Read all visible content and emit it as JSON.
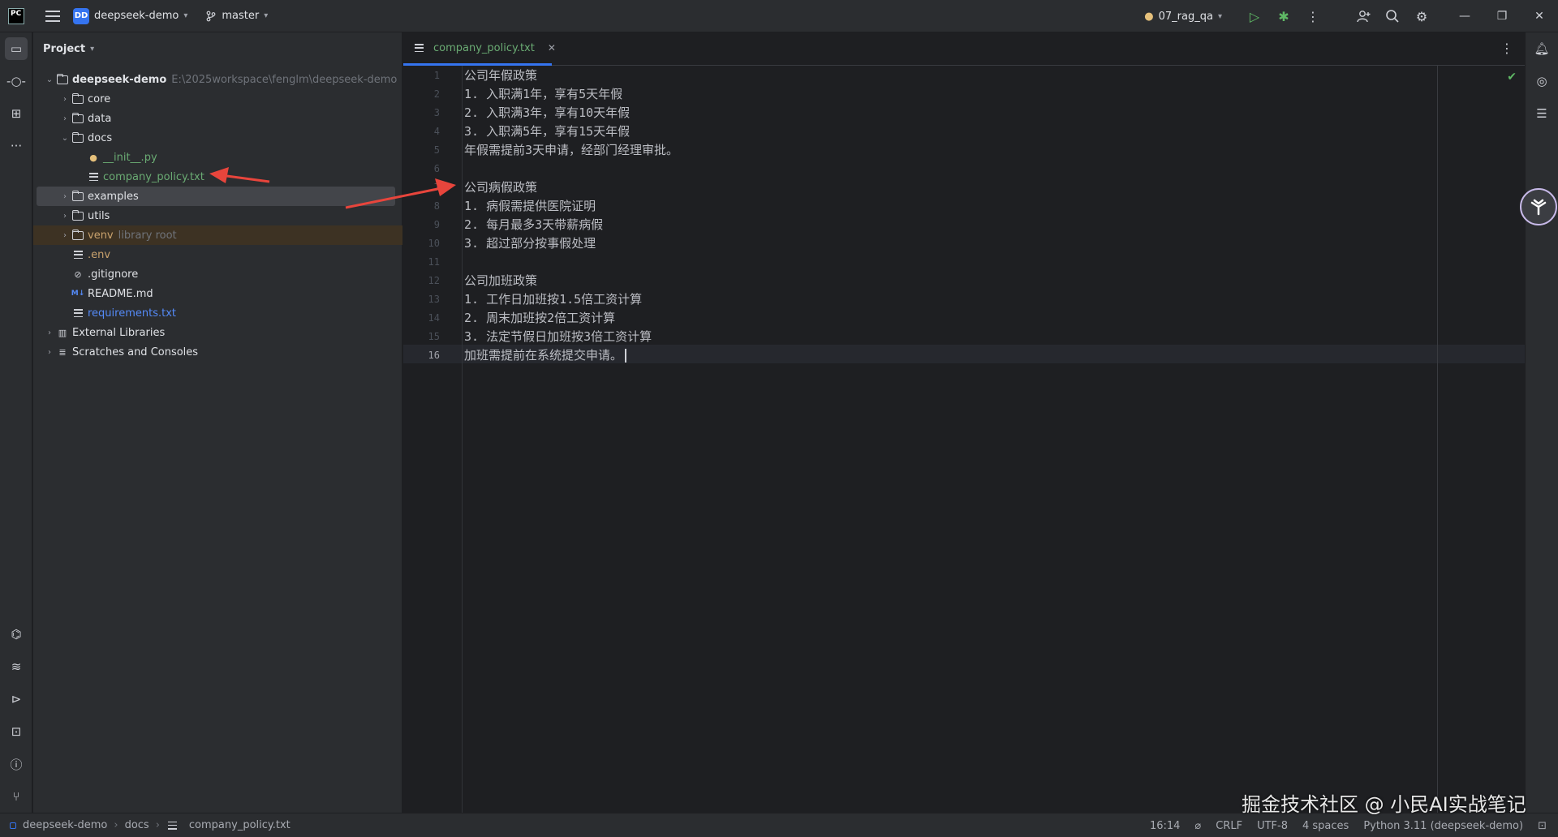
{
  "titlebar": {
    "logo": "PC",
    "project_badge": "DD",
    "project_name": "deepseek-demo",
    "branch": "master",
    "run_config": "07_rag_qa"
  },
  "project_panel": {
    "title": "Project",
    "tree": [
      {
        "label": "deepseek-demo",
        "path": "E:\\2025workspace\\fenglm\\deepseek-demo",
        "type": "folder",
        "depth": 0,
        "expanded": true
      },
      {
        "label": "core",
        "type": "folder",
        "depth": 1,
        "expanded": false
      },
      {
        "label": "data",
        "type": "folder",
        "depth": 1,
        "expanded": false
      },
      {
        "label": "docs",
        "type": "folder",
        "depth": 1,
        "expanded": true
      },
      {
        "label": "__init__.py",
        "type": "python",
        "depth": 2
      },
      {
        "label": "company_policy.txt",
        "type": "text",
        "depth": 2
      },
      {
        "label": "examples",
        "type": "folder",
        "depth": 1,
        "expanded": false,
        "selected": true
      },
      {
        "label": "utils",
        "type": "folder",
        "depth": 1,
        "expanded": false
      },
      {
        "label": "venv",
        "suffix": "library root",
        "type": "folder",
        "depth": 1,
        "expanded": false
      },
      {
        "label": ".env",
        "type": "text",
        "depth": 1
      },
      {
        "label": ".gitignore",
        "type": "ignore",
        "depth": 1
      },
      {
        "label": "README.md",
        "type": "markdown",
        "depth": 1
      },
      {
        "label": "requirements.txt",
        "type": "text",
        "depth": 1
      },
      {
        "label": "External Libraries",
        "type": "library",
        "depth": 0,
        "expanded": false
      },
      {
        "label": "Scratches and Consoles",
        "type": "scratch",
        "depth": 0,
        "expanded": false
      }
    ]
  },
  "editor": {
    "tab_label": "company_policy.txt",
    "lines": [
      "公司年假政策",
      "1. 入职满1年，享有5天年假",
      "2. 入职满3年，享有10天年假",
      "3. 入职满5年，享有15天年假",
      "年假需提前3天申请，经部门经理审批。",
      "",
      "公司病假政策",
      "1. 病假需提供医院证明",
      "2. 每月最多3天带薪病假",
      "3. 超过部分按事假处理",
      "",
      "公司加班政策",
      "1. 工作日加班按1.5倍工资计算",
      "2. 周末加班按2倍工资计算",
      "3. 法定节假日加班按3倍工资计算",
      "加班需提前在系统提交申请。"
    ],
    "current_line": 16
  },
  "statusbar": {
    "breadcrumbs": [
      "deepseek-demo",
      "docs",
      "company_policy.txt"
    ],
    "position": "16:14",
    "line_separator": "CRLF",
    "encoding": "UTF-8",
    "indent": "4 spaces",
    "interpreter": "Python 3.11 (deepseek-demo)"
  },
  "watermark": "掘金技术社区 @ 小民AI实战笔记",
  "colors": {
    "accent": "#3574f0",
    "file_green": "#6aab73",
    "link_blue": "#548af7",
    "background": "#1e1f22",
    "annotation_arrow": "#e8453c"
  }
}
